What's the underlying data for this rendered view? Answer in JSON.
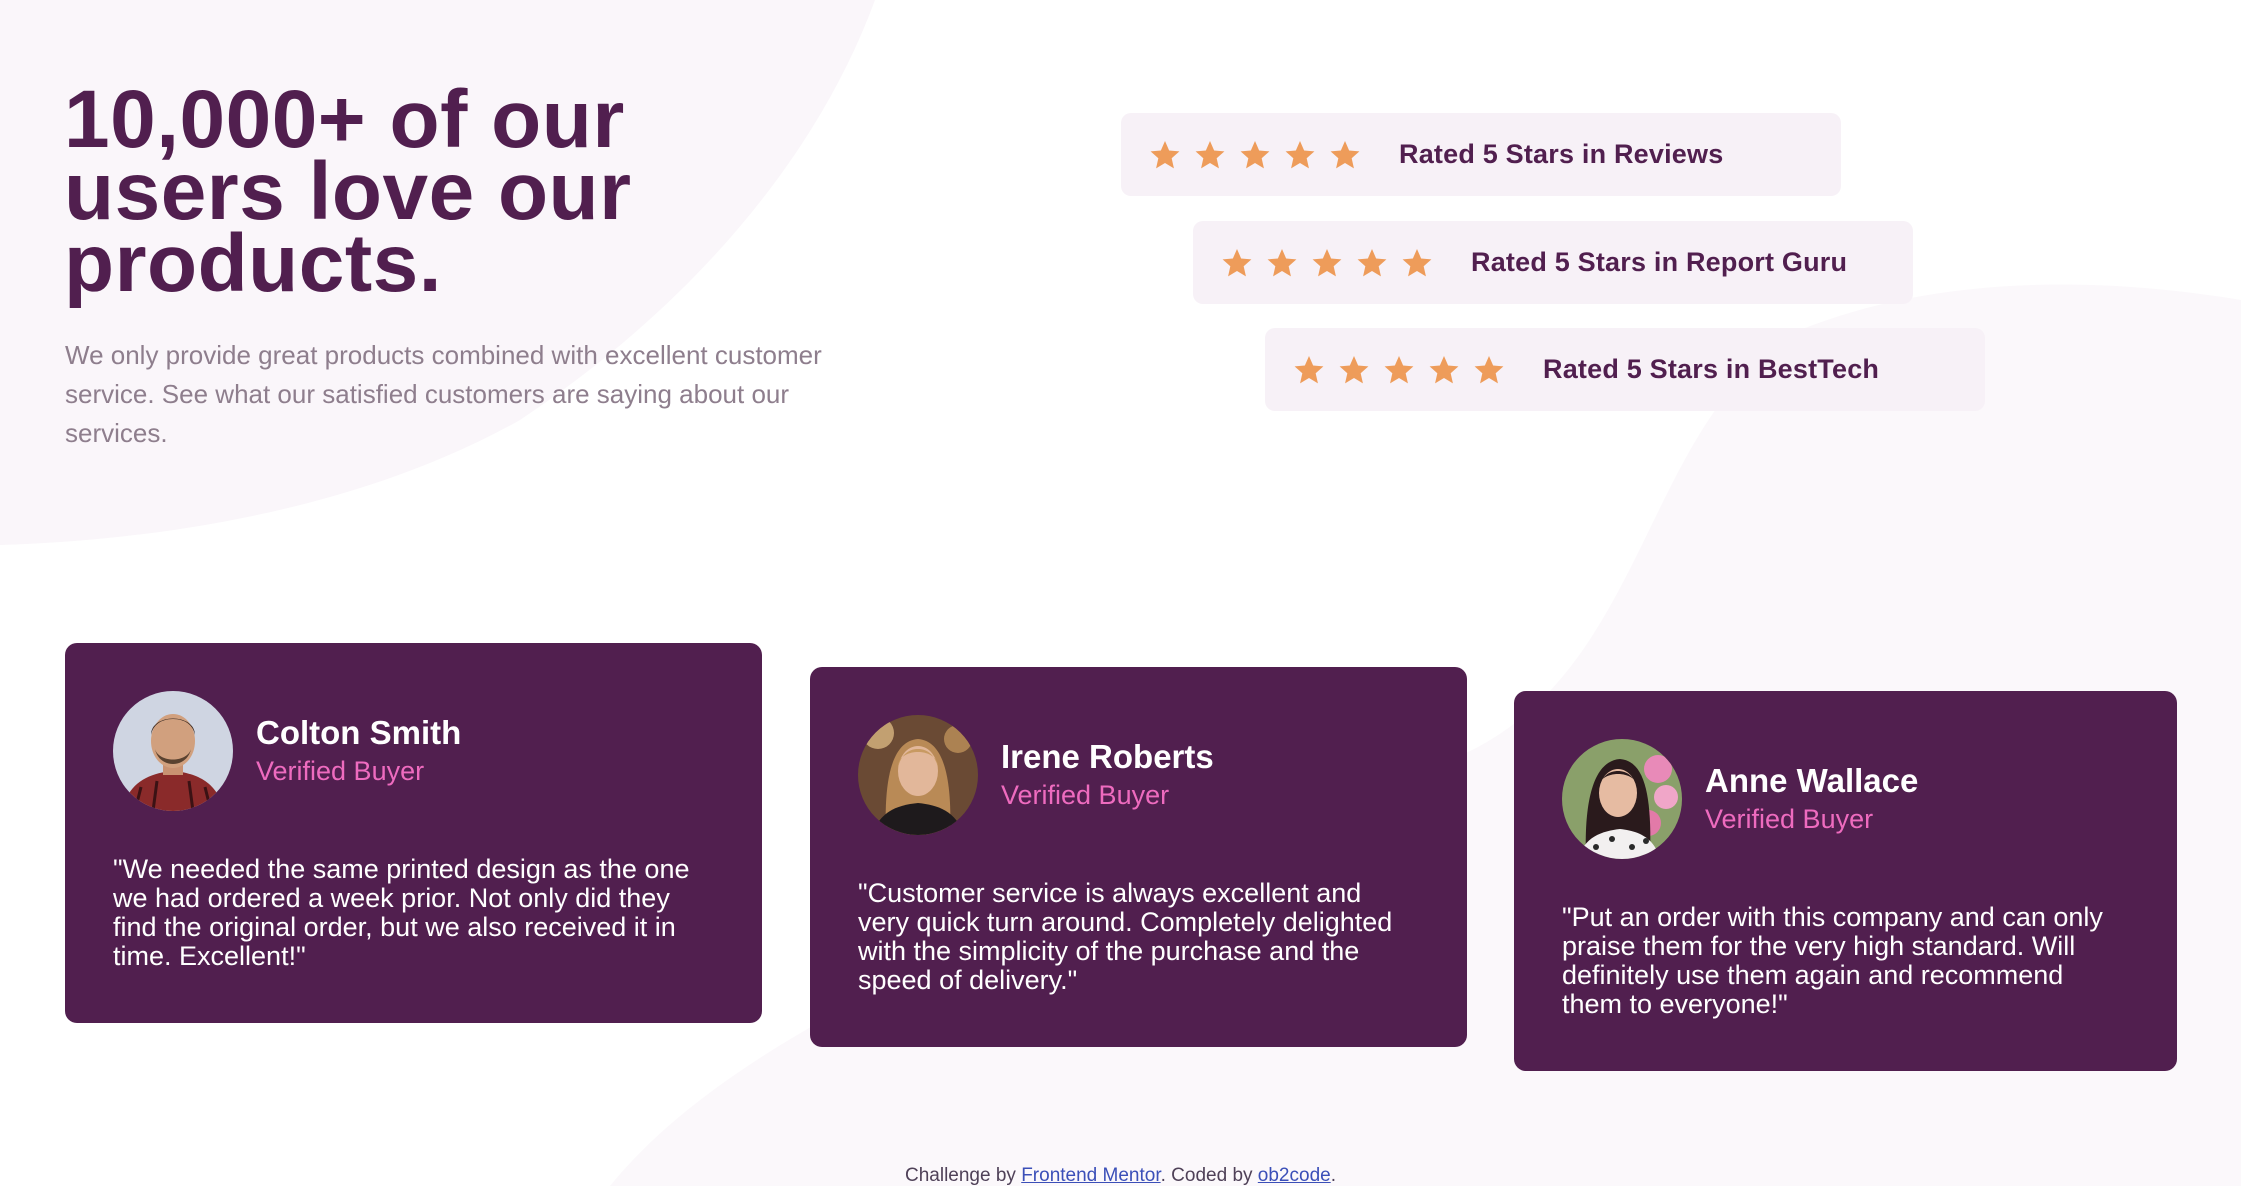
{
  "colors": {
    "primary": "#511f4f",
    "accent": "#ee6bbf",
    "star": "#ee9c5a",
    "rating_bg": "#f7f1f7",
    "muted_text": "#8e7e8d"
  },
  "hero": {
    "title": "10,000+ of our users love our products.",
    "description": "We only provide great products combined with excellent customer service. See what our satisfied customers are saying about our services."
  },
  "ratings": [
    {
      "stars": 5,
      "label": "Rated 5 Stars in Reviews",
      "icon": "star-icon"
    },
    {
      "stars": 5,
      "label": "Rated 5 Stars in Report Guru",
      "icon": "star-icon"
    },
    {
      "stars": 5,
      "label": "Rated 5 Stars in BestTech",
      "icon": "star-icon"
    }
  ],
  "testimonials": [
    {
      "name": "Colton Smith",
      "badge": "Verified Buyer",
      "quote": "\"We needed the same printed design as the one we had ordered a week prior. Not only did they find the original order, but we also received it in time. Excellent!\""
    },
    {
      "name": "Irene Roberts",
      "badge": "Verified Buyer",
      "quote": "\"Customer service is always excellent and very quick turn around. Completely delighted with the simplicity of the purchase and the speed of delivery.\""
    },
    {
      "name": "Anne Wallace",
      "badge": "Verified Buyer",
      "quote": "\"Put an order with this company and can only praise them for the very high standard. Will definitely use them again and recommend them to everyone!\""
    }
  ],
  "footer": {
    "prefix": "Challenge by ",
    "link1": "Frontend Mentor",
    "middle": ". Coded by ",
    "link2": "ob2code",
    "suffix": "."
  }
}
